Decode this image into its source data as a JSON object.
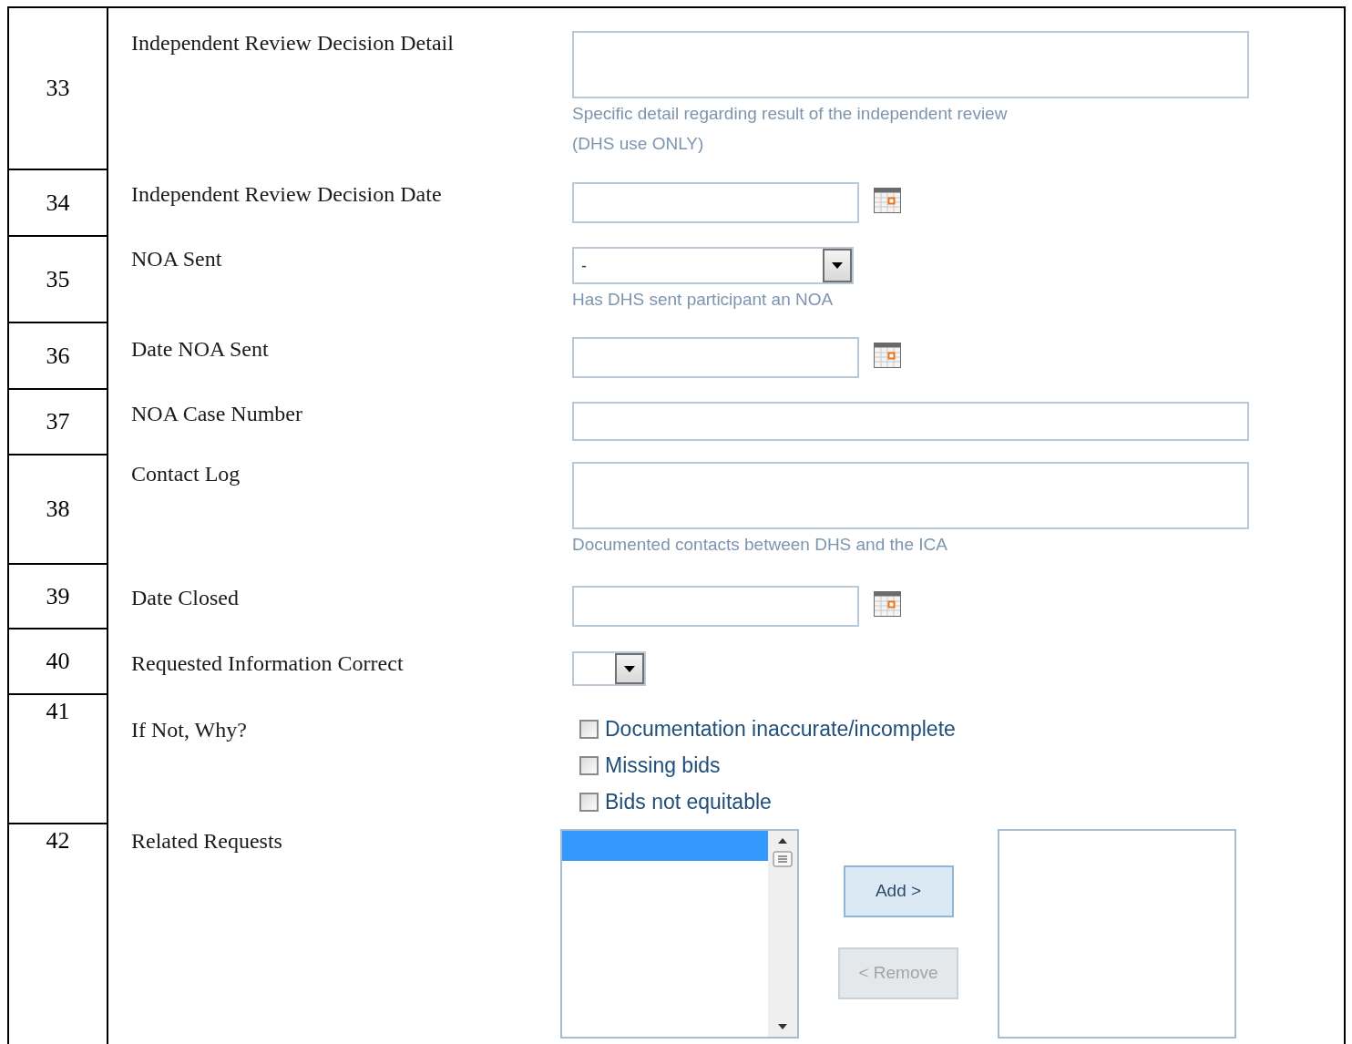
{
  "rows": [
    {
      "number": "33",
      "label": "Independent Review Decision Detail",
      "kind": "textarea",
      "hints": [
        "Specific detail regarding result of the independent review",
        "(DHS use ONLY)"
      ]
    },
    {
      "number": "34",
      "label": "Independent Review Decision Date",
      "kind": "date"
    },
    {
      "number": "35",
      "label": "NOA Sent",
      "kind": "select",
      "value": "-",
      "hints": [
        "Has DHS sent participant an NOA"
      ]
    },
    {
      "number": "36",
      "label": "Date NOA Sent",
      "kind": "date"
    },
    {
      "number": "37",
      "label": "NOA Case Number",
      "kind": "text"
    },
    {
      "number": "38",
      "label": "Contact Log",
      "kind": "textarea",
      "hints": [
        "Documented contacts between DHS and the ICA"
      ]
    },
    {
      "number": "39",
      "label": "Date Closed",
      "kind": "date"
    },
    {
      "number": "40",
      "label": "Requested Information Correct",
      "kind": "small-select"
    },
    {
      "number": "41",
      "label": "If Not, Why?",
      "kind": "checkboxes",
      "options": [
        {
          "label": "Documentation inaccurate/incomplete",
          "checked": false
        },
        {
          "label": "Missing bids",
          "checked": false
        },
        {
          "label": "Bids not equitable",
          "checked": false
        }
      ]
    },
    {
      "number": "42",
      "label": "Related Requests",
      "kind": "picker",
      "available_items": [
        {
          "selected": true
        }
      ],
      "add_button": {
        "label": "Add >",
        "disabled": false
      },
      "remove_button": {
        "label": "< Remove",
        "disabled": true
      }
    }
  ]
}
